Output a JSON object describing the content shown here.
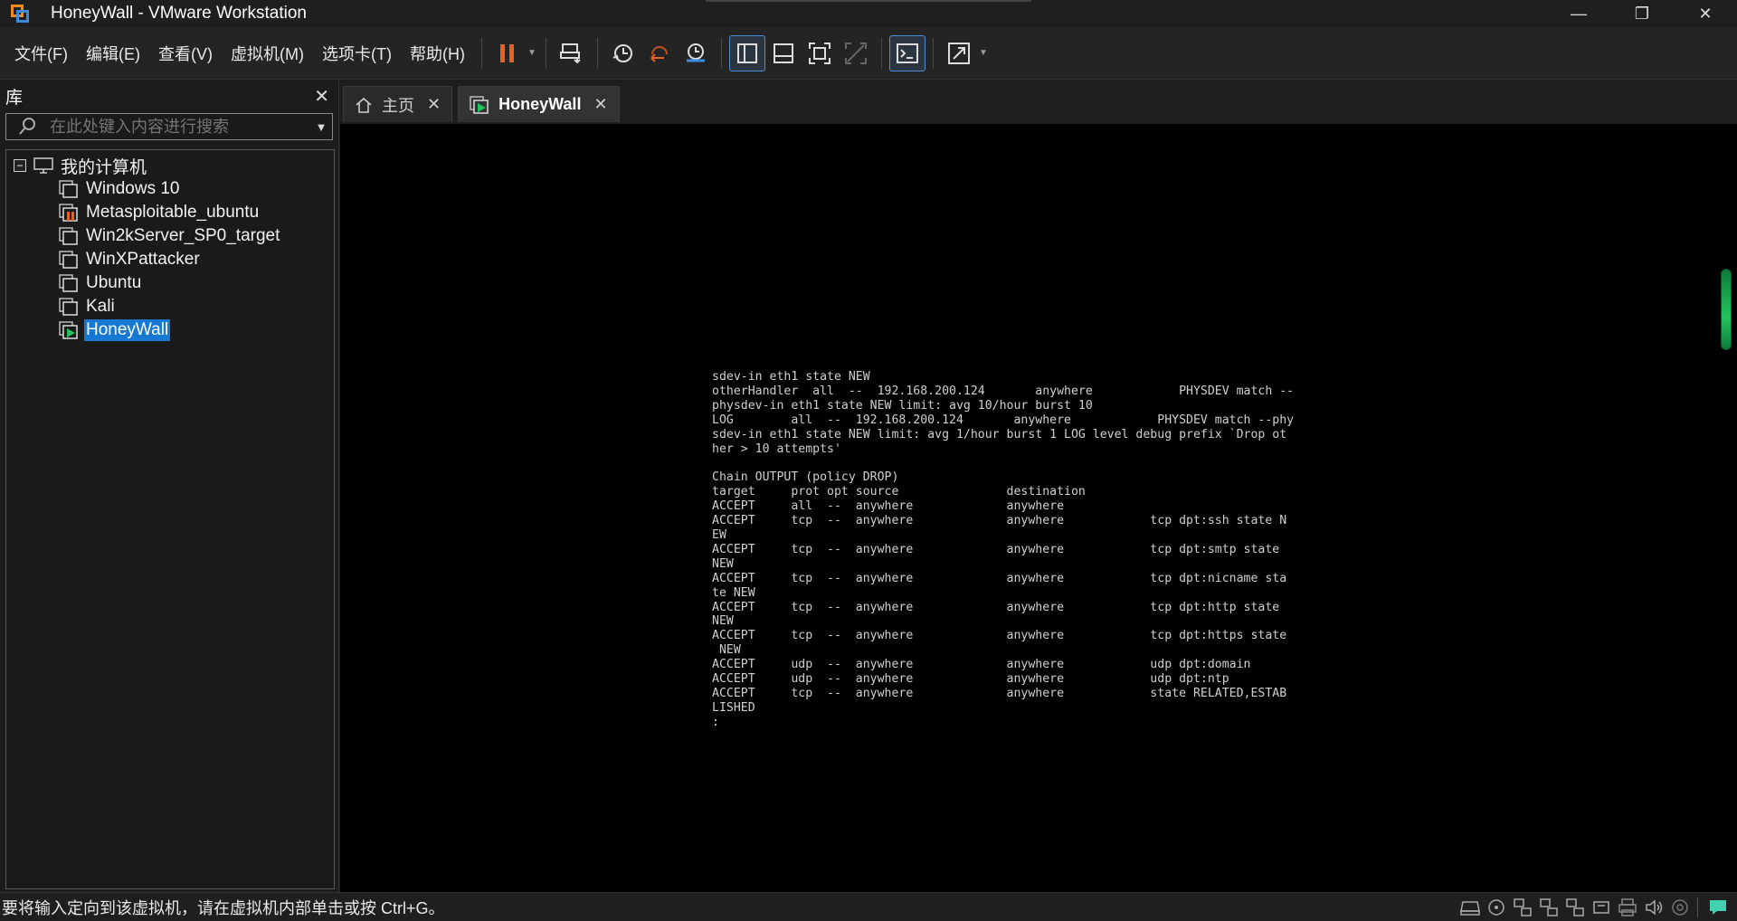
{
  "window": {
    "title": "HoneyWall - VMware Workstation",
    "min_glyph": "—",
    "max_glyph": "❐",
    "close_glyph": "✕"
  },
  "menu": [
    {
      "label": "文件(F)"
    },
    {
      "label": "编辑(E)"
    },
    {
      "label": "查看(V)"
    },
    {
      "label": "虚拟机(M)"
    },
    {
      "label": "选项卡(T)"
    },
    {
      "label": "帮助(H)"
    }
  ],
  "colors": {
    "accent": "#1778d2",
    "pause": "#e8621f",
    "green": "#22c55e"
  },
  "library": {
    "title": "库",
    "close_glyph": "✕",
    "search_placeholder": "在此处键入内容进行搜索",
    "root": {
      "label": "我的计算机",
      "expander": "−"
    },
    "vms": [
      {
        "label": "Windows 10",
        "state": "off"
      },
      {
        "label": "Metasploitable_ubuntu",
        "state": "paused"
      },
      {
        "label": "Win2kServer_SP0_target",
        "state": "off"
      },
      {
        "label": "WinXPattacker",
        "state": "off"
      },
      {
        "label": "Ubuntu",
        "state": "off"
      },
      {
        "label": "Kali",
        "state": "off"
      },
      {
        "label": "HoneyWall",
        "state": "running",
        "selected": true
      }
    ]
  },
  "tabs": [
    {
      "label": "主页",
      "close": "✕"
    },
    {
      "label": "HoneyWall",
      "close": "✕",
      "active": true
    }
  ],
  "console": {
    "text": "sdev-in eth1 state NEW\notherHandler  all  --  192.168.200.124       anywhere            PHYSDEV match --\nphysdev-in eth1 state NEW limit: avg 10/hour burst 10\nLOG        all  --  192.168.200.124       anywhere            PHYSDEV match --phy\nsdev-in eth1 state NEW limit: avg 1/hour burst 1 LOG level debug prefix `Drop ot\nher > 10 attempts'\n\nChain OUTPUT (policy DROP)\ntarget     prot opt source               destination\nACCEPT     all  --  anywhere             anywhere\nACCEPT     tcp  --  anywhere             anywhere            tcp dpt:ssh state N\nEW\nACCEPT     tcp  --  anywhere             anywhere            tcp dpt:smtp state\nNEW\nACCEPT     tcp  --  anywhere             anywhere            tcp dpt:nicname sta\nte NEW\nACCEPT     tcp  --  anywhere             anywhere            tcp dpt:http state\nNEW\nACCEPT     tcp  --  anywhere             anywhere            tcp dpt:https state\n NEW\nACCEPT     udp  --  anywhere             anywhere            udp dpt:domain\nACCEPT     udp  --  anywhere             anywhere            udp dpt:ntp\nACCEPT     tcp  --  anywhere             anywhere            state RELATED,ESTAB\nLISHED\n:"
  },
  "status": {
    "text": "要将输入定向到该虚拟机，请在虚拟机内部单击或按 Ctrl+G。"
  }
}
